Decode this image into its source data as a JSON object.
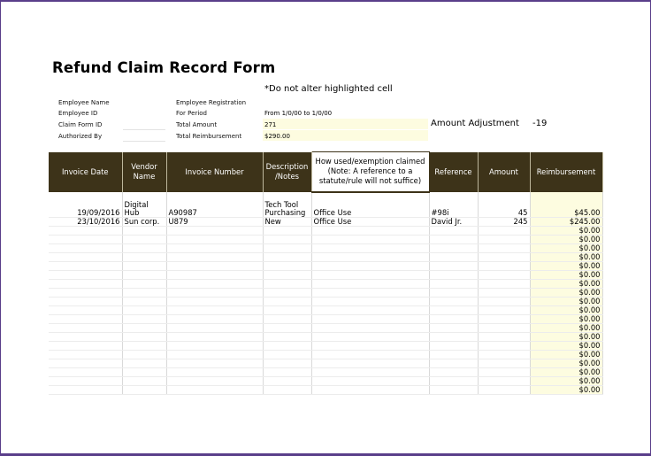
{
  "form": {
    "title": "Refund Claim Record Form",
    "note": "*Do not alter highlighted cell"
  },
  "info": {
    "employee_name_label": "Employee Name",
    "employee_id_label": "Employee ID",
    "claim_form_id_label": "Claim Form ID",
    "authorized_by_label": "Authorized By",
    "employee_registration_label": "Employee Registration",
    "for_period_label": "For Period",
    "for_period_value": "From 1/0/00 to 1/0/00",
    "total_amount_label": "Total Amount",
    "total_amount_value": "271",
    "total_reimbursement_label": "Total Reimbursement",
    "total_reimbursement_value": "$290.00",
    "amount_adjustment_label": "Amount Adjustment",
    "amount_adjustment_value": "-19"
  },
  "table": {
    "headers": {
      "invoice_date": "Invoice Date",
      "vendor_name": "Vendor Name",
      "invoice_number": "Invoice Number",
      "description": "Description /Notes",
      "how_used": "How used/exemption claimed (Note: A reference to a statute/rule will not suffice)",
      "reference": "Reference",
      "amount": "Amount",
      "reimbursement": "Reimbursement"
    },
    "rows": [
      {
        "invoice_date": "19/09/2016",
        "vendor_name": "Digital Hub",
        "invoice_number": "A90987",
        "description": "Tech Tool Purchasing",
        "how_used": "Office Use",
        "reference": "#98i",
        "amount": "45",
        "reimbursement": "$45.00"
      },
      {
        "invoice_date": "23/10/2016",
        "vendor_name": "Sun corp.",
        "invoice_number": "U879",
        "description": "New",
        "how_used": "Office Use",
        "reference": "David Jr.",
        "amount": "245",
        "reimbursement": "$245.00"
      },
      {
        "invoice_date": "",
        "vendor_name": "",
        "invoice_number": "",
        "description": "",
        "how_used": "",
        "reference": "",
        "amount": "",
        "reimbursement": "$0.00"
      },
      {
        "invoice_date": "",
        "vendor_name": "",
        "invoice_number": "",
        "description": "",
        "how_used": "",
        "reference": "",
        "amount": "",
        "reimbursement": "$0.00"
      },
      {
        "invoice_date": "",
        "vendor_name": "",
        "invoice_number": "",
        "description": "",
        "how_used": "",
        "reference": "",
        "amount": "",
        "reimbursement": "$0.00"
      },
      {
        "invoice_date": "",
        "vendor_name": "",
        "invoice_number": "",
        "description": "",
        "how_used": "",
        "reference": "",
        "amount": "",
        "reimbursement": "$0.00"
      },
      {
        "invoice_date": "",
        "vendor_name": "",
        "invoice_number": "",
        "description": "",
        "how_used": "",
        "reference": "",
        "amount": "",
        "reimbursement": "$0.00"
      },
      {
        "invoice_date": "",
        "vendor_name": "",
        "invoice_number": "",
        "description": "",
        "how_used": "",
        "reference": "",
        "amount": "",
        "reimbursement": "$0.00"
      },
      {
        "invoice_date": "",
        "vendor_name": "",
        "invoice_number": "",
        "description": "",
        "how_used": "",
        "reference": "",
        "amount": "",
        "reimbursement": "$0.00"
      },
      {
        "invoice_date": "",
        "vendor_name": "",
        "invoice_number": "",
        "description": "",
        "how_used": "",
        "reference": "",
        "amount": "",
        "reimbursement": "$0.00"
      },
      {
        "invoice_date": "",
        "vendor_name": "",
        "invoice_number": "",
        "description": "",
        "how_used": "",
        "reference": "",
        "amount": "",
        "reimbursement": "$0.00"
      },
      {
        "invoice_date": "",
        "vendor_name": "",
        "invoice_number": "",
        "description": "",
        "how_used": "",
        "reference": "",
        "amount": "",
        "reimbursement": "$0.00"
      },
      {
        "invoice_date": "",
        "vendor_name": "",
        "invoice_number": "",
        "description": "",
        "how_used": "",
        "reference": "",
        "amount": "",
        "reimbursement": "$0.00"
      },
      {
        "invoice_date": "",
        "vendor_name": "",
        "invoice_number": "",
        "description": "",
        "how_used": "",
        "reference": "",
        "amount": "",
        "reimbursement": "$0.00"
      },
      {
        "invoice_date": "",
        "vendor_name": "",
        "invoice_number": "",
        "description": "",
        "how_used": "",
        "reference": "",
        "amount": "",
        "reimbursement": "$0.00"
      },
      {
        "invoice_date": "",
        "vendor_name": "",
        "invoice_number": "",
        "description": "",
        "how_used": "",
        "reference": "",
        "amount": "",
        "reimbursement": "$0.00"
      },
      {
        "invoice_date": "",
        "vendor_name": "",
        "invoice_number": "",
        "description": "",
        "how_used": "",
        "reference": "",
        "amount": "",
        "reimbursement": "$0.00"
      },
      {
        "invoice_date": "",
        "vendor_name": "",
        "invoice_number": "",
        "description": "",
        "how_used": "",
        "reference": "",
        "amount": "",
        "reimbursement": "$0.00"
      },
      {
        "invoice_date": "",
        "vendor_name": "",
        "invoice_number": "",
        "description": "",
        "how_used": "",
        "reference": "",
        "amount": "",
        "reimbursement": "$0.00"
      },
      {
        "invoice_date": "",
        "vendor_name": "",
        "invoice_number": "",
        "description": "",
        "how_used": "",
        "reference": "",
        "amount": "",
        "reimbursement": "$0.00"
      },
      {
        "invoice_date": "",
        "vendor_name": "",
        "invoice_number": "",
        "description": "",
        "how_used": "",
        "reference": "",
        "amount": "",
        "reimbursement": "$0.00"
      }
    ]
  }
}
